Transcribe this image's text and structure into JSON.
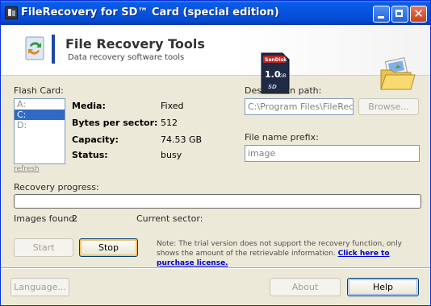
{
  "window": {
    "title": "FileRecovery for SD™ Card (special edition)"
  },
  "banner": {
    "logo_title": "File Recovery Tools",
    "logo_subtitle": "Data recovery software tools",
    "card_brand": "SanDisk",
    "card_capacity": "1.0",
    "card_unit": "GB",
    "card_logo": "SD"
  },
  "flash_card": {
    "label": "Flash Card:",
    "drives": [
      "A:",
      "C:",
      "D:"
    ],
    "selected_index": 1,
    "refresh_label": "refresh"
  },
  "info": {
    "media_label": "Media:",
    "media_value": "Fixed",
    "bps_label": "Bytes per sector:",
    "bps_value": "512",
    "capacity_label": "Capacity:",
    "capacity_value": "74.53 GB",
    "status_label": "Status:",
    "status_value": "busy"
  },
  "destination": {
    "label": "Destination path:",
    "value": "C:\\Program Files\\FileRecov",
    "browse_label": "Browse..."
  },
  "prefix": {
    "label": "File name prefix:",
    "value": "image"
  },
  "progress": {
    "label": "Recovery progress:",
    "value": 0
  },
  "stats": {
    "images_label": "Images found:",
    "images_value": "2",
    "sector_label": "Current sector:",
    "sector_value": ""
  },
  "actions": {
    "start_label": "Start",
    "stop_label": "Stop"
  },
  "note": {
    "text": "Note: The trial version does not support the recovery function, only shows the amount of the retrievable information.",
    "link": "Click here to purchase license."
  },
  "footer": {
    "language_label": "Language...",
    "about_label": "About",
    "help_label": "Help"
  },
  "colors": {
    "title_bar": "#0653e0",
    "selection": "#316ac5",
    "link": "#0000cc"
  }
}
